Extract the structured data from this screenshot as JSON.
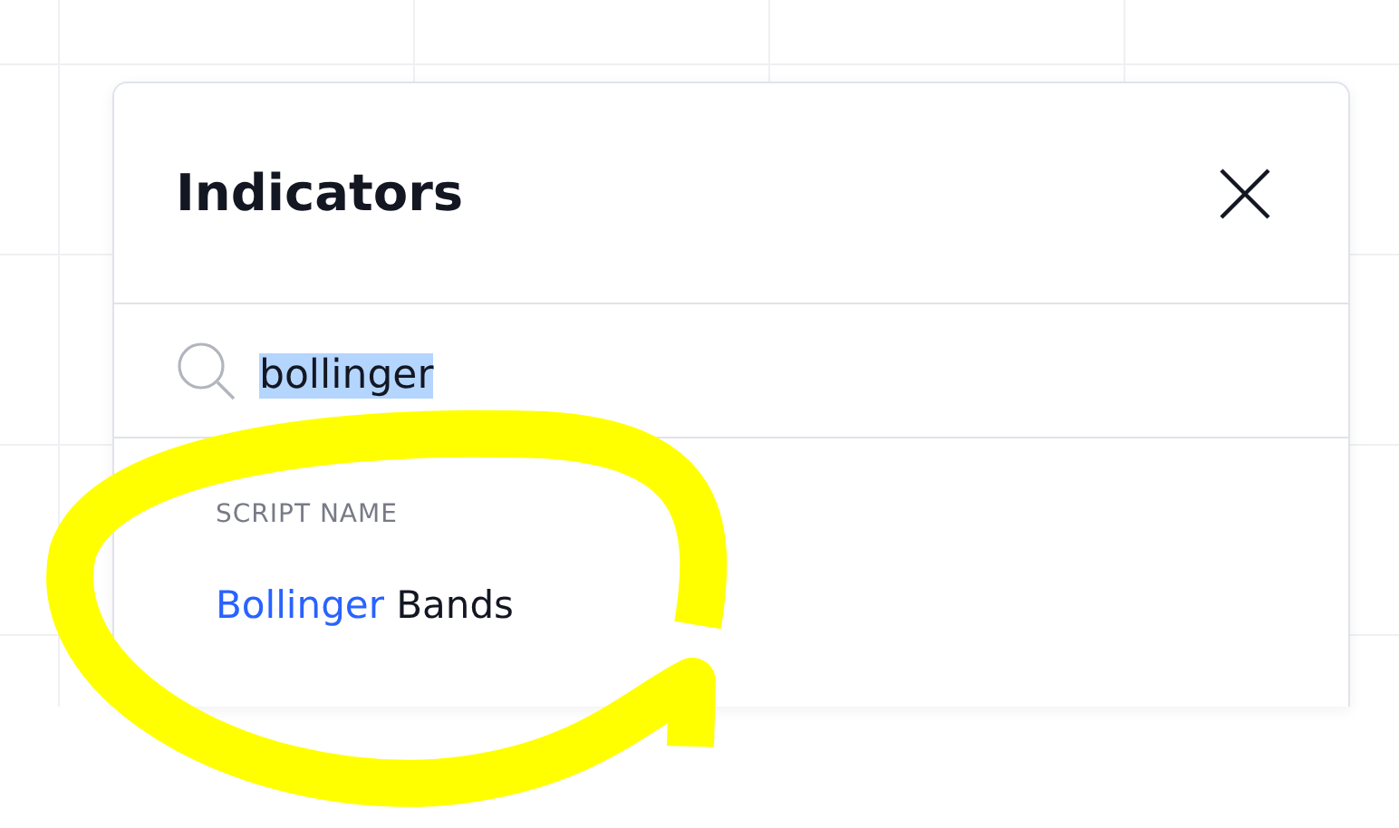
{
  "dialog": {
    "title": "Indicators",
    "search": {
      "value": "bollinger",
      "selected": true
    },
    "sections": [
      {
        "heading": "SCRIPT NAME",
        "results": [
          {
            "parts": [
              {
                "text": "Bollinger",
                "match": true
              },
              {
                "text": "Bands",
                "match": false
              }
            ]
          }
        ]
      }
    ]
  }
}
